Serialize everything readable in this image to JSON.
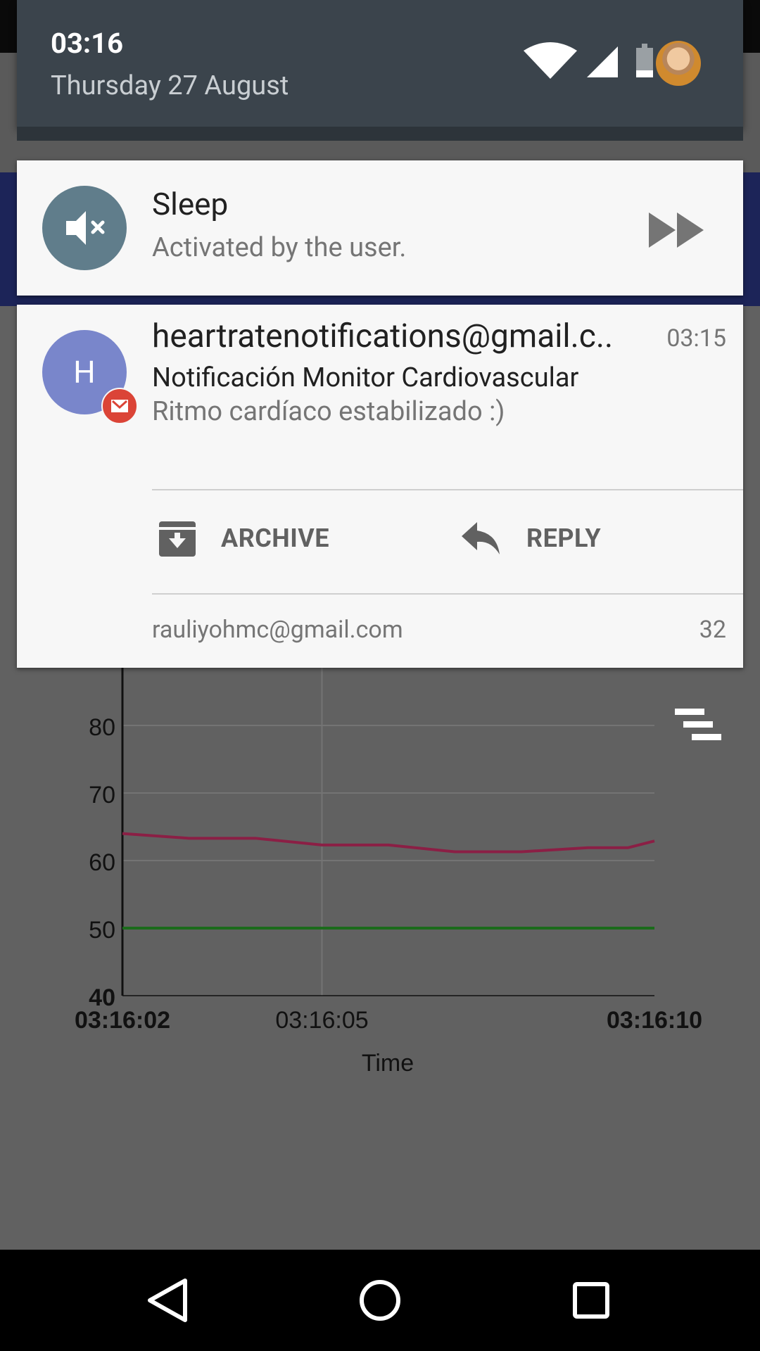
{
  "status": {
    "time": "03:16",
    "date": "Thursday 27 August"
  },
  "notifications": {
    "sleep": {
      "title": "Sleep",
      "subtitle": "Activated by the user."
    },
    "email": {
      "avatar_letter": "H",
      "from": "heartratenotifications@gmail.c..",
      "time": "03:15",
      "subject": "Notificación Monitor Cardiovascular",
      "body": "Ritmo cardíaco estabilizado :)",
      "archive_label": "ARCHIVE",
      "reply_label": "REPLY",
      "account": "rauliyohmc@gmail.com",
      "count": "32"
    }
  },
  "chart_data": {
    "type": "line",
    "xlabel": "Time",
    "ylabel": "",
    "ylim": [
      40,
      90
    ],
    "y_ticks": [
      40,
      50,
      60,
      70,
      80
    ],
    "x_ticks": [
      "03:16:02",
      "03:16:05",
      "03:16:10"
    ],
    "x_range": [
      0,
      8
    ],
    "x_tick_positions": [
      0,
      3,
      8
    ],
    "grid": true,
    "series": [
      {
        "color": "#8b1f45",
        "x": [
          0,
          1,
          2,
          3,
          4,
          5,
          6,
          7,
          7.6,
          8
        ],
        "values": [
          64,
          63.3,
          63.3,
          62.3,
          62.3,
          61.3,
          61.3,
          61.9,
          61.9,
          62.9
        ]
      },
      {
        "color": "#1b6b1b",
        "x": [
          0,
          8
        ],
        "values": [
          50,
          50
        ]
      }
    ]
  },
  "nav": {
    "icons": [
      "back-icon",
      "home-icon",
      "recents-icon"
    ]
  },
  "colors": {
    "shade_header": "#3b444c",
    "sleep_icon_bg": "#607d8b",
    "mail_avatar_bg": "#7986cb",
    "gmail_badge": "#db4437"
  }
}
